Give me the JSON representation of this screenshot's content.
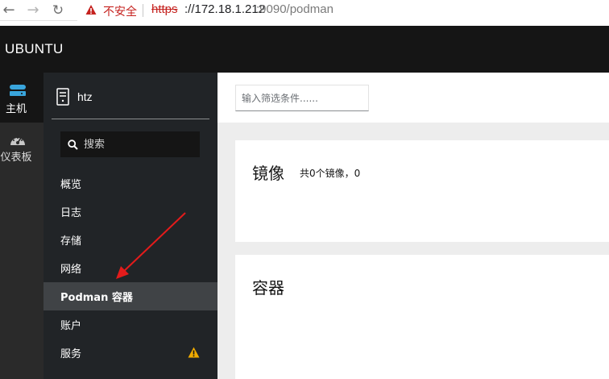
{
  "browser": {
    "security_label": "不安全",
    "url_scheme": "https",
    "url_host": "://172.18.1.212",
    "url_path": ":9090/podman"
  },
  "header": {
    "brand": "UBUNTU"
  },
  "rail": {
    "items": [
      {
        "label": "主机",
        "icon": "server-stack-icon"
      },
      {
        "label": "仪表板",
        "icon": "dashboard-icon"
      }
    ]
  },
  "navpanel": {
    "host_name": "htz",
    "search_placeholder": "搜索",
    "items": [
      {
        "label": "概览"
      },
      {
        "label": "日志"
      },
      {
        "label": "存储"
      },
      {
        "label": "网络"
      },
      {
        "label": "Podman 容器",
        "active": true
      },
      {
        "label": "账户"
      },
      {
        "label": "服务",
        "warning": true
      }
    ]
  },
  "main": {
    "filter_placeholder": "输入筛选条件......",
    "images_title": "镜像",
    "images_subtitle": "共0个镜像，0",
    "containers_title": "容器"
  },
  "colors": {
    "header_bg": "#151515",
    "nav_bg": "#212427",
    "active_item_bg": "#404346",
    "warning": "#f0ab00",
    "insecure_red": "#c5221f",
    "annotation_arrow": "#e31b1b"
  }
}
